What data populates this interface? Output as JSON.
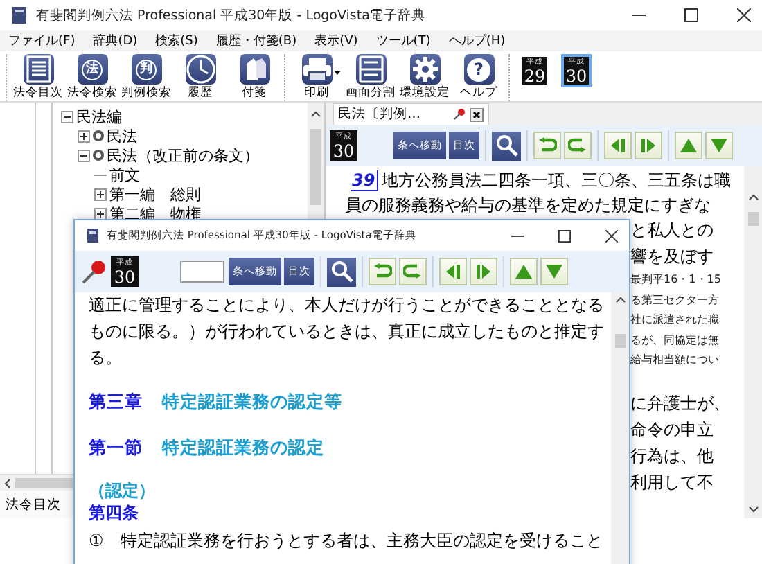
{
  "window": {
    "title": "有斐閣判例六法 Professional 平成30年版 - LogoVista電子辞典"
  },
  "menu": [
    "ファイル(F)",
    "辞典(D)",
    "検索(S)",
    "履歴・付箋(B)",
    "表示(V)",
    "ツール(T)",
    "ヘルプ(H)"
  ],
  "toolbar": {
    "groups": [
      [
        {
          "kind": "list",
          "label": "法令目次"
        },
        {
          "kind": "glyph",
          "glyph": "法",
          "label": "法令検索"
        },
        {
          "kind": "glyph",
          "glyph": "判",
          "label": "判例検索"
        },
        {
          "kind": "clock",
          "label": "履歴"
        },
        {
          "kind": "tags",
          "label": "付箋"
        }
      ],
      [
        {
          "kind": "printer",
          "label": "印刷"
        },
        {
          "kind": "split",
          "label": "画面分割"
        },
        {
          "kind": "gear",
          "label": "環境設定"
        },
        {
          "kind": "help",
          "glyph": "?",
          "label": "ヘルプ"
        }
      ]
    ],
    "eras": [
      {
        "era": "平成",
        "year": "29",
        "selected": false
      },
      {
        "era": "平成",
        "year": "30",
        "selected": true
      }
    ]
  },
  "tree": [
    {
      "label": "民法編",
      "kind": "part",
      "expanded": true,
      "children": [
        {
          "label": "民法",
          "kind": "law",
          "expanded": false
        },
        {
          "label": "民法（改正前の条文）",
          "kind": "law",
          "expanded": true,
          "children": [
            {
              "label": "前文",
              "kind": "part"
            },
            {
              "label": "第一編　総則",
              "kind": "part",
              "expanded": false
            },
            {
              "label": "第二編　物権",
              "kind": "part",
              "expanded": false
            }
          ]
        }
      ]
    }
  ],
  "bottom_tab": "法令目次",
  "doc": {
    "tab": "民法〔判例…",
    "era": "平成",
    "year": "30",
    "jump": "条へ移動",
    "toc": "目次",
    "ref": "39",
    "lines": [
      "地方公務員法二四条一項、三〇条、三五条は職",
      "員の服務義務や給与の基準を定めた規定にすぎな"
    ],
    "fragments": [
      {
        "kind": "large",
        "text": "と私人との"
      },
      {
        "kind": "large",
        "text": "響を及ぼす"
      },
      {
        "kind": "small",
        "text": "最判平16・1・15"
      },
      {
        "kind": "small",
        "text": "る第三セクター方"
      },
      {
        "kind": "small",
        "text": "社に派遣された職"
      },
      {
        "kind": "small",
        "text": "るが、同協定は無"
      },
      {
        "kind": "small",
        "text": "給与相当額につい"
      },
      {
        "kind": "paragraph",
        "text": "に弁護士が、"
      },
      {
        "kind": "large",
        "text": "命令の申立"
      },
      {
        "kind": "large",
        "text": "行為は、他"
      },
      {
        "kind": "large",
        "text": "利用して不"
      }
    ]
  },
  "popup": {
    "title": "有斐閣判例六法 Professional 平成30年版 - LogoVista電子辞典",
    "era": "平成",
    "year": "30",
    "jump": "条へ移動",
    "toc": "目次",
    "paragraphs": [
      {
        "kind": "body",
        "text": "適正に管理することにより、本人だけが行うことができることとなるものに限る。）が行われているときは、真正に成立したものと推定する。"
      },
      {
        "kind": "heading",
        "num": "第三章",
        "text": "特定認証業務の認定等"
      },
      {
        "kind": "heading",
        "num": "第一節",
        "text": "特定認証業務の認定"
      },
      {
        "kind": "caption",
        "text": "（認定）"
      },
      {
        "kind": "article",
        "text": "第四条"
      },
      {
        "kind": "body",
        "text": "①　特定認証業務を行おうとする者は、主務大臣の認定を受けること"
      }
    ]
  }
}
